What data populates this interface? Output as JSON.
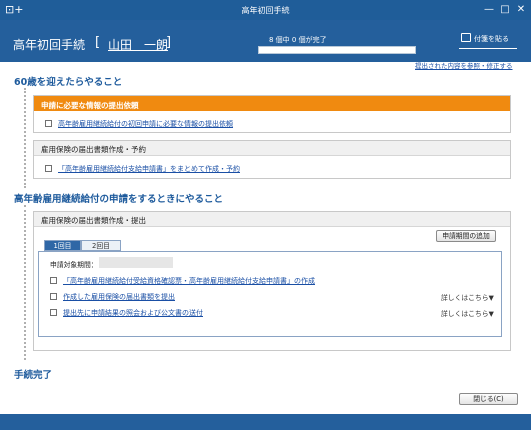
{
  "window": {
    "title": "高年初回手続",
    "app_icon": "app-plus-icon",
    "minimize": "—",
    "maximize": "□",
    "close": "✕"
  },
  "header": {
    "title": "高年初回手続",
    "bracket_open": "[",
    "user_name": "山田　一朗",
    "bracket_close": "]",
    "progress_label": "8 個中 0 個が完了",
    "progress_done": 0,
    "progress_total": 8,
    "note_button": "付箋を貼る",
    "note_icon": "sticky-note-icon"
  },
  "review_link": "提出された内容を参照・修正する",
  "section1": {
    "title": "60歳を迎えたらやること",
    "card1": {
      "header": "申請に必要な情報の提出依頼",
      "task": "高年齢雇用継続給付の初回申請に必要な情報の提出依頼"
    },
    "card2": {
      "header": "雇用保険の届出書類作成・予約",
      "task": "「高年齢雇用継続給付支給申請書」をまとめて作成・予約"
    }
  },
  "section2": {
    "title": "高年齢雇用継続給付の申請をするときにやること",
    "card": {
      "header": "雇用保険の届出書類作成・提出",
      "add_period_button": "申請期間の追加",
      "tabs": [
        "1回目",
        "2回目"
      ],
      "period_label": "申請対象期間：",
      "tasks": [
        {
          "label": "「高年齢雇用継続給付受給資格確認票・高年齢雇用継続給付支給申請書」の作成",
          "detail": ""
        },
        {
          "label": "作成した雇用保険の届出書類を提出",
          "detail": "詳しくはこちら▼"
        },
        {
          "label": "提出先に申請結果の照会および公文書の送付",
          "detail": "詳しくはこちら▼"
        }
      ]
    }
  },
  "complete_label": "手続完了",
  "close_button": "閉じる(C)",
  "colors": {
    "header_bg": "#245f9c",
    "section_title": "#1d5a9c",
    "orange_header": "#f08a10",
    "link": "#1a4fa5"
  }
}
